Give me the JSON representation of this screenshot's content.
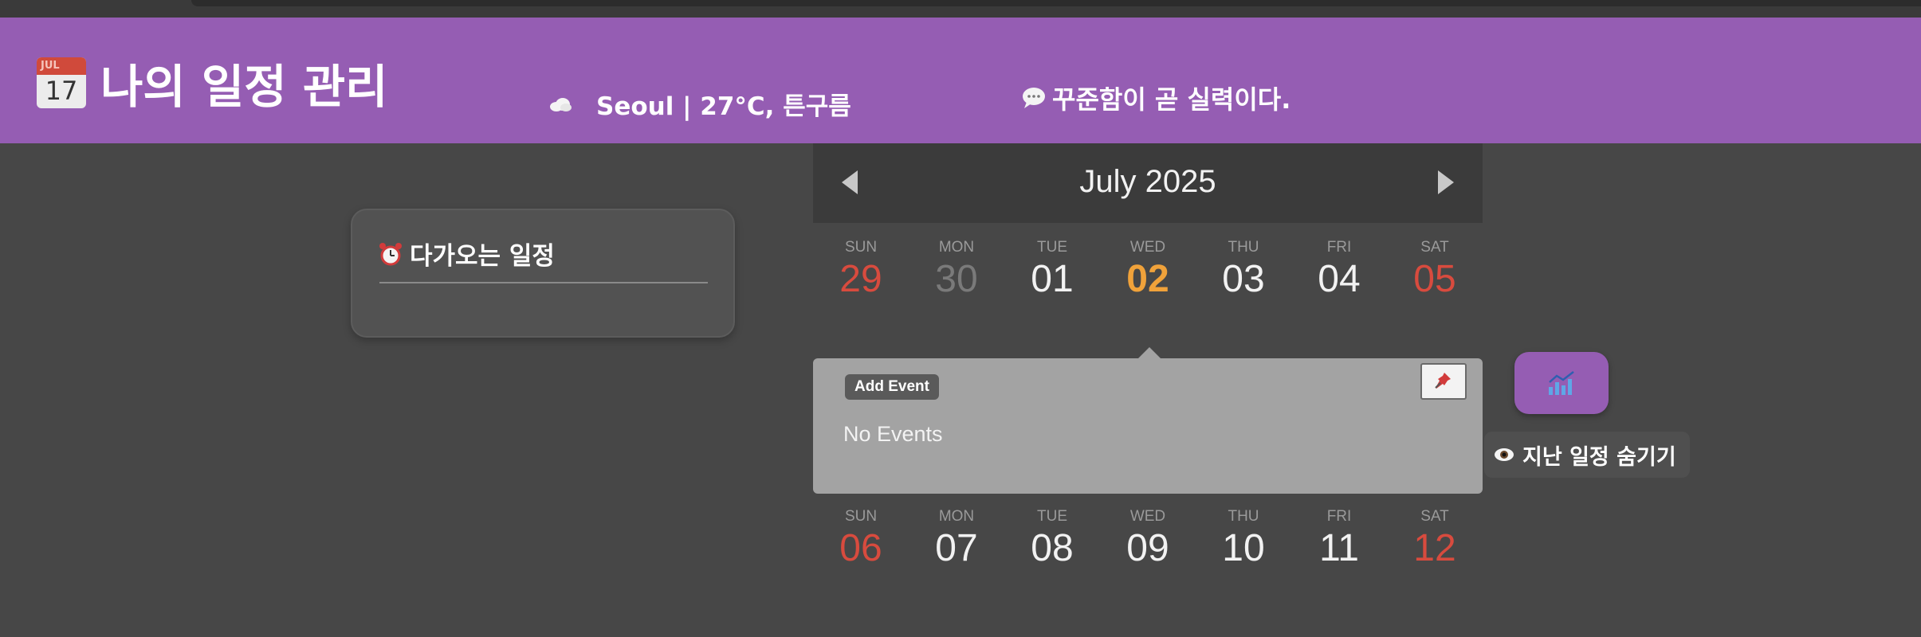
{
  "header": {
    "icon_month": "JUL",
    "icon_day": "17",
    "title": "나의 일정 관리",
    "weather_icon": "cloud-icon",
    "weather": "Seoul | 27°C, 튼구름",
    "quote_icon": "speech-bubble-icon",
    "quote": "꾸준함이 곧 실력이다."
  },
  "upcoming": {
    "icon": "alarm-clock-icon",
    "title": "다가오는 일정"
  },
  "calendar": {
    "month_title": "July 2025",
    "weeks": [
      {
        "days": [
          {
            "dow": "SUN",
            "num": "29"
          },
          {
            "dow": "MON",
            "num": "30"
          },
          {
            "dow": "TUE",
            "num": "01"
          },
          {
            "dow": "WED",
            "num": "02"
          },
          {
            "dow": "THU",
            "num": "03"
          },
          {
            "dow": "FRI",
            "num": "04"
          },
          {
            "dow": "SAT",
            "num": "05"
          }
        ]
      },
      {
        "days": [
          {
            "dow": "SUN",
            "num": "06"
          },
          {
            "dow": "MON",
            "num": "07"
          },
          {
            "dow": "TUE",
            "num": "08"
          },
          {
            "dow": "WED",
            "num": "09"
          },
          {
            "dow": "THU",
            "num": "10"
          },
          {
            "dow": "FRI",
            "num": "11"
          },
          {
            "dow": "SAT",
            "num": "12"
          }
        ]
      }
    ]
  },
  "event_panel": {
    "add_event_label": "Add Event",
    "pin_icon": "pushpin-icon",
    "empty_text": "No Events"
  },
  "actions": {
    "stats_icon": "chart-icon",
    "hide_past_icon": "eye-icon",
    "hide_past_label": "지난 일정 숨기기"
  },
  "colors": {
    "accent": "#955db3",
    "background": "#474747",
    "weekend": "#d84b3e",
    "today": "#f0a23a",
    "panel": "#a3a3a3"
  }
}
